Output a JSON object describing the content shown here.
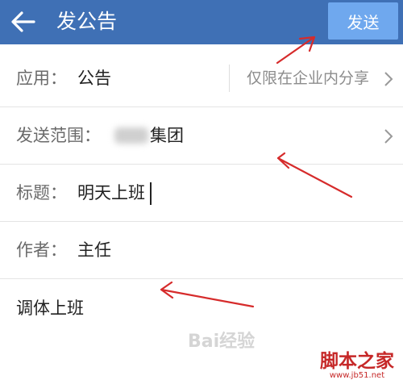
{
  "header": {
    "title": "发公告",
    "send_label": "发送",
    "back_icon": "arrow-left-icon"
  },
  "rows": {
    "app": {
      "label": "应用：",
      "value": "公告",
      "scope": "仅限在企业内分享"
    },
    "range": {
      "label": "发送范围：",
      "value": "集团"
    },
    "title": {
      "label": "标题：",
      "value": "明天上班"
    },
    "author": {
      "label": "作者：",
      "value": "主任"
    }
  },
  "body": {
    "text": "调体上班"
  },
  "watermark": {
    "text": "Bai经验"
  },
  "site_logo": {
    "text": "脚本之家",
    "url": "www.jb51.net"
  },
  "colors": {
    "header_bg": "#3f70b5",
    "send_button_bg": "#6fa8ee",
    "annotation_arrow": "#d62b2b"
  }
}
